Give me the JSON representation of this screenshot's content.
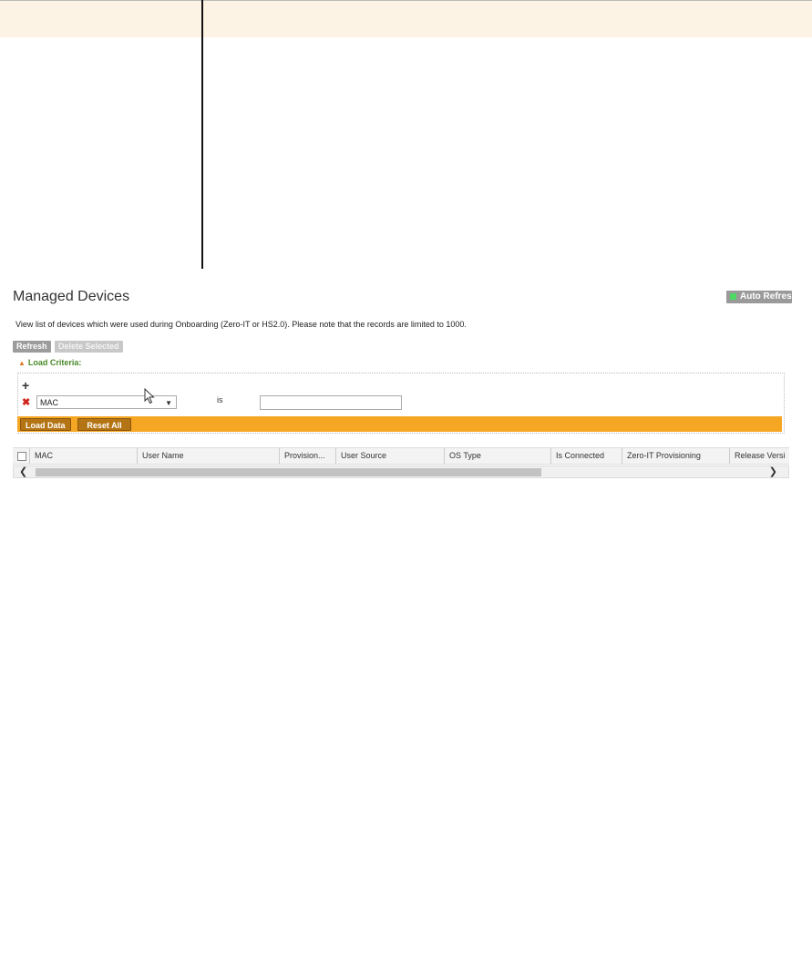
{
  "page": {
    "title": "Managed Devices",
    "auto_refresh": "Auto Refresh",
    "description": "View list of devices which were used during Onboarding (Zero-IT or HS2.0). Please note that the records are limited to 1000."
  },
  "toolbar": {
    "refresh_label": "Refresh",
    "delete_label": "Delete Selected"
  },
  "criteria": {
    "section_label": "Load Criteria:",
    "add_symbol": "+",
    "remove_symbol": "✖",
    "field_value": "MAC",
    "operator_label": "is",
    "value_input": "",
    "load_data_label": "Load Data",
    "reset_all_label": "Reset All"
  },
  "grid": {
    "columns": [
      "MAC",
      "User Name",
      "Provision...",
      "User Source",
      "OS Type",
      "Is Connected",
      "Zero-IT Provisioning",
      "Release Versi"
    ]
  },
  "colors": {
    "accent_orange": "#f5a623",
    "button_brown": "#b47414",
    "label_green": "#4a8a2a",
    "remove_red": "#d0251b",
    "status_green": "#4cd964"
  }
}
